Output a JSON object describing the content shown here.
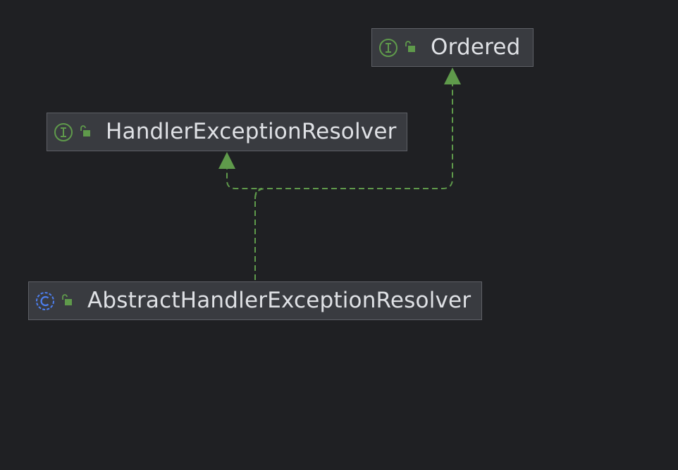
{
  "diagram": {
    "nodes": [
      {
        "id": "ordered",
        "kind": "interface",
        "kind_icon": "interface-icon",
        "visibility_icon": "public-lock-icon",
        "label": "Ordered"
      },
      {
        "id": "her",
        "kind": "interface",
        "kind_icon": "interface-icon",
        "visibility_icon": "public-lock-icon",
        "label": "HandlerExceptionResolver"
      },
      {
        "id": "aher",
        "kind": "abstract-class",
        "kind_icon": "abstract-class-icon",
        "visibility_icon": "public-lock-icon",
        "label": "AbstractHandlerExceptionResolver"
      }
    ],
    "edges": [
      {
        "from": "aher",
        "to": "her",
        "relation": "implements",
        "style": "dashed"
      },
      {
        "from": "aher",
        "to": "ordered",
        "relation": "implements",
        "style": "dashed"
      }
    ]
  },
  "colors": {
    "background": "#1f2023",
    "node_fill": "#393b40",
    "node_border": "#5e6066",
    "label": "#dfe1e5",
    "edge": "#5f9a4b",
    "interface_icon": "#5f9a4b",
    "abstract_class_icon": "#4d7ff0",
    "lock_icon": "#5f9a4b"
  }
}
